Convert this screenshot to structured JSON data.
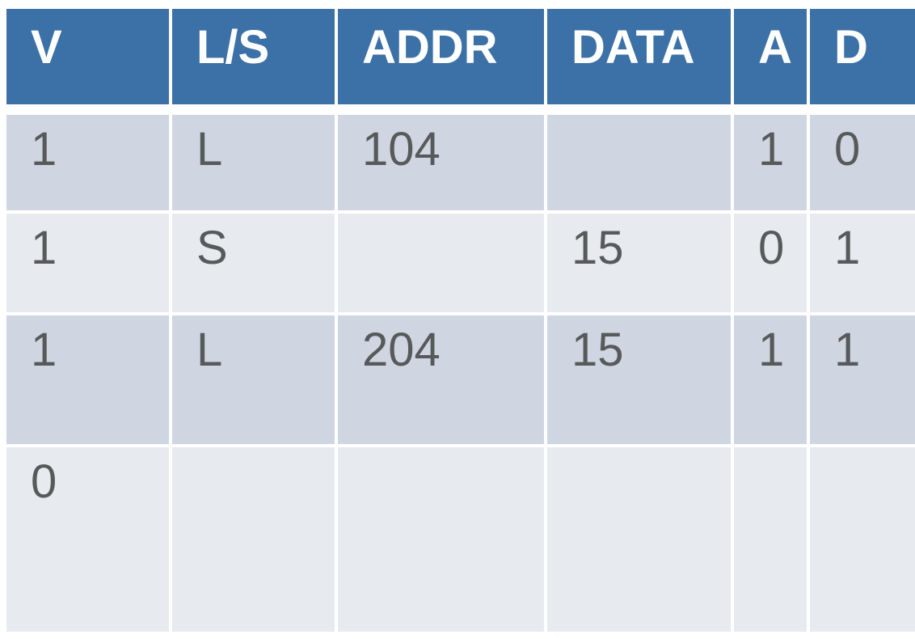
{
  "table": {
    "headers": [
      "V",
      "L/S",
      "ADDR",
      "DATA",
      "A",
      "D"
    ],
    "rows": [
      [
        "1",
        "L",
        "104",
        "",
        "1",
        "0"
      ],
      [
        "1",
        "S",
        "",
        "15",
        "0",
        "1"
      ],
      [
        "1",
        "L",
        "204",
        "15",
        "1",
        "1"
      ],
      [
        "0",
        "",
        "",
        "",
        "",
        ""
      ]
    ]
  },
  "colors": {
    "header_bg": "#3c71a7",
    "row_odd": "#cfd6e1",
    "row_even": "#e7ebf0",
    "text": "#58595b"
  }
}
